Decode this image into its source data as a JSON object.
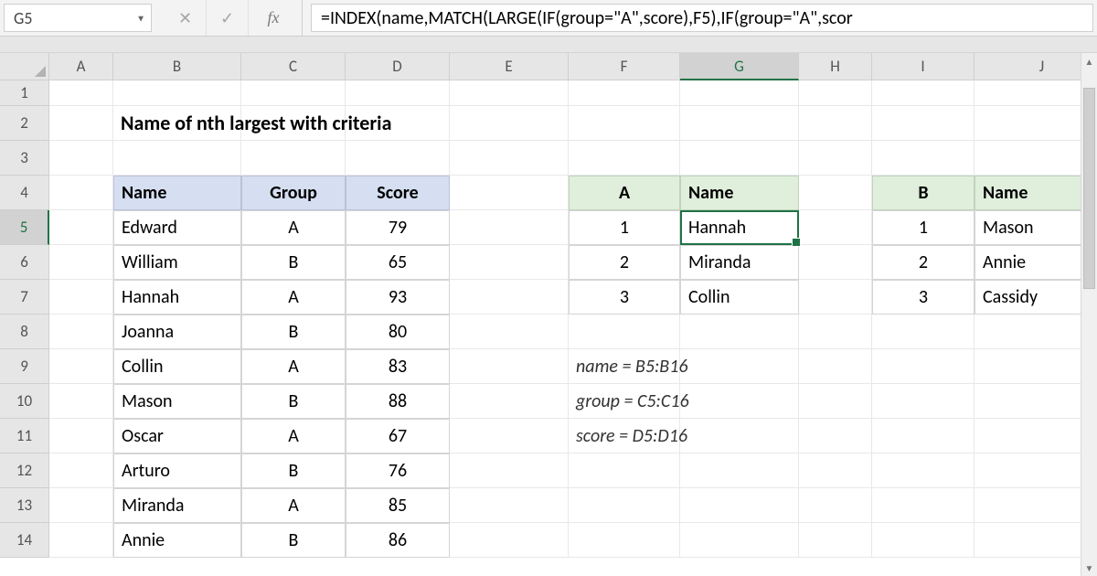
{
  "formula_bar": {
    "name_box": "G5",
    "cancel": "✕",
    "enter": "✓",
    "fx": "fx",
    "formula": "=INDEX(name,MATCH(LARGE(IF(group=\"A\",score),F5),IF(group=\"A\",scor"
  },
  "columns": [
    "A",
    "B",
    "C",
    "D",
    "E",
    "F",
    "G",
    "H",
    "I",
    "J"
  ],
  "rows": [
    "1",
    "2",
    "3",
    "4",
    "5",
    "6",
    "7",
    "8",
    "9",
    "10",
    "11",
    "12",
    "13",
    "14"
  ],
  "active_col": "G",
  "active_row": "5",
  "title": "Name of nth largest with criteria",
  "main_table": {
    "headers": [
      "Name",
      "Group",
      "Score"
    ],
    "rows": [
      [
        "Edward",
        "A",
        "79"
      ],
      [
        "William",
        "B",
        "65"
      ],
      [
        "Hannah",
        "A",
        "93"
      ],
      [
        "Joanna",
        "B",
        "80"
      ],
      [
        "Collin",
        "A",
        "83"
      ],
      [
        "Mason",
        "B",
        "88"
      ],
      [
        "Oscar",
        "A",
        "67"
      ],
      [
        "Arturo",
        "B",
        "76"
      ],
      [
        "Miranda",
        "A",
        "85"
      ],
      [
        "Annie",
        "B",
        "86"
      ]
    ]
  },
  "group_a": {
    "headers": [
      "A",
      "Name"
    ],
    "rows": [
      [
        "1",
        "Hannah"
      ],
      [
        "2",
        "Miranda"
      ],
      [
        "3",
        "Collin"
      ]
    ]
  },
  "group_b": {
    "headers": [
      "B",
      "Name"
    ],
    "rows": [
      [
        "1",
        "Mason"
      ],
      [
        "2",
        "Annie"
      ],
      [
        "3",
        "Cassidy"
      ]
    ]
  },
  "notes": [
    "name = B5:B16",
    "group = C5:C16",
    "score = D5:D16"
  ]
}
